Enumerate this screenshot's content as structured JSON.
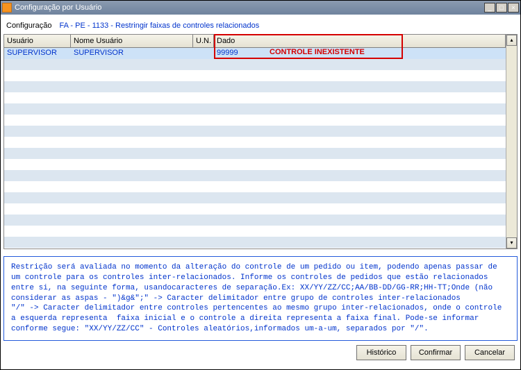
{
  "window": {
    "title": "Configuração por Usuário"
  },
  "config": {
    "label": "Configuração",
    "value": "FA - PE - 1133 - Restringir faixas de controles relacionados"
  },
  "grid": {
    "headers": {
      "usuario": "Usuário",
      "nome": "Nome Usuário",
      "un": "U.N.",
      "dado": "Dado"
    },
    "rows": [
      {
        "usuario": "SUPERVISOR",
        "nome": "SUPERVISOR",
        "un": "",
        "dado": "99999"
      }
    ],
    "error_label": "CONTROLE INEXISTENTE"
  },
  "description": "Restrição será avaliada no momento da alteração do controle de um pedido ou item, podendo apenas passar de um controle para os controles inter-relacionados. Informe os controles de pedidos que estão relacionados entre si, na seguinte forma, usandocaracteres de separação.Ex: XX/YY/ZZ/CC;AA/BB-DD/GG-RR;HH-TT;Onde (não considerar as aspas - \")&g&\";\" -> Caracter delimitador entre grupo de controles inter-relacionados\n\"/\" -> Caracter delimitador entre controles pertencentes ao mesmo grupo inter-relacionados, onde o controle a esquerda representa  faixa inicial e o controle a direita representa a faixa final. Pode-se informar conforme segue: \"XX/YY/ZZ/CC\" - Controles aleatórios,informados um-a-um, separados por \"/\".",
  "buttons": {
    "historico": "Histórico",
    "confirmar": "Confirmar",
    "cancelar": "Cancelar"
  }
}
